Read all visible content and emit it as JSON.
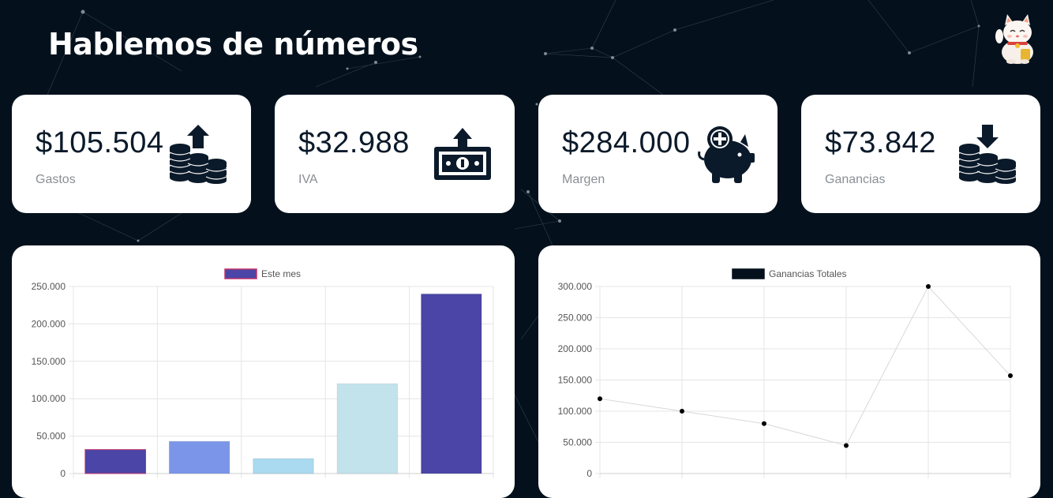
{
  "page": {
    "title": "Hablemos de números"
  },
  "stats": [
    {
      "value": "$105.504",
      "label": "Gastos",
      "icon": "coins-up-icon"
    },
    {
      "value": "$32.988",
      "label": "IVA",
      "icon": "money-up-icon"
    },
    {
      "value": "$284.000",
      "label": "Margen",
      "icon": "piggy-bank-plus-icon"
    },
    {
      "value": "$73.842",
      "label": "Ganancias",
      "icon": "coins-down-icon"
    }
  ],
  "colors": {
    "background": "#04111c",
    "card": "#ffffff",
    "bar_series": [
      "#4a45a6",
      "#7b96e8",
      "#a9daf0",
      "#c2e2ec",
      "#4a45a6"
    ],
    "line_point": "#000000"
  },
  "chart_data": [
    {
      "type": "bar",
      "legend": "Este mes",
      "series": [
        {
          "name": "Este mes",
          "values": [
            32000,
            43000,
            20000,
            120000,
            240000
          ]
        }
      ],
      "ylim": [
        0,
        250000
      ],
      "yticks": [
        "250.000",
        "200.000",
        "150.000",
        "100.000",
        "50.000",
        "0"
      ],
      "grid": true,
      "legend_position": "top"
    },
    {
      "type": "line",
      "legend": "Ganancias Totales",
      "series": [
        {
          "name": "Ganancias Totales",
          "values": [
            120000,
            100000,
            80000,
            45000,
            300000,
            157000
          ]
        }
      ],
      "ylim": [
        0,
        300000
      ],
      "yticks": [
        "300.000",
        "250.000",
        "200.000",
        "150.000",
        "100.000",
        "50.000",
        "0"
      ],
      "grid": true,
      "legend_position": "top"
    }
  ]
}
